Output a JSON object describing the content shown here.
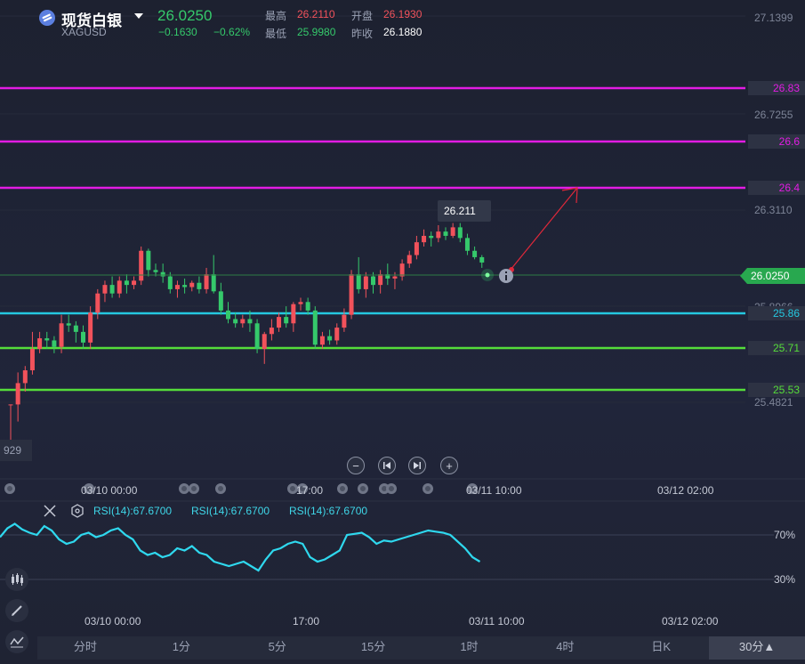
{
  "header": {
    "symbol_name": "现货白银",
    "symbol_code": "XAGUSD",
    "price": "26.0250",
    "change": "−0.1630",
    "change_pct": "−0.62%",
    "high_label": "最高",
    "high_value": "26.2110",
    "open_label": "开盘",
    "open_value": "26.1930",
    "low_label": "最低",
    "low_value": "25.9980",
    "prev_close_label": "昨收",
    "prev_close_value": "26.1880"
  },
  "price_axis": {
    "labels": [
      "27.1399",
      "26.7255",
      "26.3110",
      "25.8966",
      "25.4821"
    ],
    "partial_left_label": "929"
  },
  "levels": [
    {
      "value": "26.83",
      "color": "#e21ce3"
    },
    {
      "value": "26.6",
      "color": "#e21ce3"
    },
    {
      "value": "26.4",
      "color": "#e21ce3"
    },
    {
      "value": "25.86",
      "color": "#25c8e0"
    },
    {
      "value": "25.71",
      "color": "#55dd3a"
    },
    {
      "value": "25.53",
      "color": "#55dd3a"
    }
  ],
  "current_price_tag": "26.0250",
  "high_tooltip": "26.211",
  "time_labels_main": [
    "03/10 00:00",
    "17:00",
    "03/11 10:00",
    "03/12 02:00"
  ],
  "time_labels_rsi": [
    "03/10 00:00",
    "17:00",
    "03/11 10:00",
    "03/12 02:00"
  ],
  "rsi": {
    "labels": [
      "RSI(14):67.6700",
      "RSI(14):67.6700",
      "RSI(14):67.6700"
    ],
    "y_labels": [
      "70%",
      "30%"
    ]
  },
  "tabs": [
    "分时",
    "1分",
    "5分",
    "15分",
    "1时",
    "4时",
    "日K",
    "30分▲"
  ],
  "colors": {
    "up": "#f2525b",
    "down": "#35c96b",
    "rsi_line": "#2fd8ee",
    "background": "#1e2230"
  },
  "chart_data": {
    "type": "candlestick",
    "ylim": [
      25.37,
      27.18
    ],
    "candles": [
      [
        25.36,
        25.36,
        25.18,
        25.36
      ],
      [
        25.36,
        25.51,
        25.28,
        25.46
      ],
      [
        25.46,
        25.54,
        25.42,
        25.52
      ],
      [
        25.52,
        25.7,
        25.5,
        25.62
      ],
      [
        25.62,
        25.7,
        25.6,
        25.67
      ],
      [
        25.67,
        25.7,
        25.62,
        25.66
      ],
      [
        25.66,
        25.68,
        25.6,
        25.63
      ],
      [
        25.63,
        25.78,
        25.6,
        25.74
      ],
      [
        25.74,
        25.78,
        25.7,
        25.73
      ],
      [
        25.73,
        25.75,
        25.65,
        25.7
      ],
      [
        25.7,
        25.73,
        25.62,
        25.65
      ],
      [
        25.65,
        25.82,
        25.62,
        25.79
      ],
      [
        25.79,
        25.9,
        25.76,
        25.88
      ],
      [
        25.88,
        25.94,
        25.84,
        25.92
      ],
      [
        25.92,
        25.96,
        25.86,
        25.88
      ],
      [
        25.88,
        25.96,
        25.86,
        25.94
      ],
      [
        25.94,
        25.97,
        25.88,
        25.92
      ],
      [
        25.92,
        25.96,
        25.9,
        25.94
      ],
      [
        25.94,
        26.1,
        25.92,
        26.08
      ],
      [
        26.08,
        26.09,
        25.96,
        25.99
      ],
      [
        25.99,
        26.02,
        25.96,
        25.98
      ],
      [
        25.98,
        26.02,
        25.93,
        25.96
      ],
      [
        25.96,
        25.98,
        25.88,
        25.9
      ],
      [
        25.9,
        25.94,
        25.86,
        25.92
      ],
      [
        25.92,
        25.95,
        25.88,
        25.91
      ],
      [
        25.91,
        25.94,
        25.89,
        25.93
      ],
      [
        25.93,
        25.96,
        25.88,
        25.9
      ],
      [
        25.9,
        26.0,
        25.88,
        25.97
      ],
      [
        25.97,
        26.06,
        25.88,
        25.89
      ],
      [
        25.89,
        25.93,
        25.78,
        25.8
      ],
      [
        25.8,
        25.84,
        25.74,
        25.76
      ],
      [
        25.76,
        25.79,
        25.72,
        25.74
      ],
      [
        25.74,
        25.78,
        25.72,
        25.76
      ],
      [
        25.76,
        25.8,
        25.7,
        25.74
      ],
      [
        25.74,
        25.76,
        25.6,
        25.62
      ],
      [
        25.62,
        25.7,
        25.55,
        25.69
      ],
      [
        25.69,
        25.76,
        25.66,
        25.72
      ],
      [
        25.72,
        25.79,
        25.7,
        25.77
      ],
      [
        25.77,
        25.82,
        25.72,
        25.74
      ],
      [
        25.74,
        25.84,
        25.7,
        25.83
      ],
      [
        25.83,
        25.86,
        25.8,
        25.84
      ],
      [
        25.84,
        25.86,
        25.78,
        25.8
      ],
      [
        25.8,
        25.82,
        25.62,
        25.64
      ],
      [
        25.64,
        25.7,
        25.62,
        25.68
      ],
      [
        25.68,
        25.71,
        25.64,
        25.66
      ],
      [
        25.66,
        25.74,
        25.64,
        25.72
      ],
      [
        25.72,
        25.81,
        25.7,
        25.78
      ],
      [
        25.78,
        25.99,
        25.76,
        25.97
      ],
      [
        25.97,
        26.05,
        25.88,
        25.9
      ],
      [
        25.9,
        25.98,
        25.86,
        25.96
      ],
      [
        25.96,
        25.98,
        25.88,
        25.92
      ],
      [
        25.92,
        25.99,
        25.88,
        25.97
      ],
      [
        25.97,
        26.02,
        25.92,
        25.95
      ],
      [
        25.95,
        25.98,
        25.9,
        25.96
      ],
      [
        25.96,
        26.04,
        25.94,
        26.02
      ],
      [
        26.02,
        26.08,
        26.0,
        26.06
      ],
      [
        26.06,
        26.15,
        26.04,
        26.12
      ],
      [
        26.12,
        26.18,
        26.1,
        26.15
      ],
      [
        26.15,
        26.17,
        26.1,
        26.14
      ],
      [
        26.14,
        26.2,
        26.12,
        26.17
      ],
      [
        26.17,
        26.19,
        26.13,
        26.15
      ],
      [
        26.15,
        26.21,
        26.14,
        26.19
      ],
      [
        26.19,
        26.21,
        26.12,
        26.14
      ],
      [
        26.14,
        26.16,
        26.06,
        26.08
      ],
      [
        26.08,
        26.1,
        26.04,
        26.05
      ],
      [
        26.05,
        26.06,
        26.0,
        26.025
      ]
    ],
    "rsi": [
      68,
      76,
      80,
      75,
      72,
      70,
      78,
      74,
      66,
      62,
      64,
      70,
      72,
      68,
      70,
      74,
      76,
      70,
      66,
      56,
      52,
      54,
      50,
      52,
      58,
      56,
      60,
      54,
      52,
      46,
      44,
      42,
      44,
      46,
      42,
      38,
      48,
      56,
      58,
      62,
      64,
      62,
      50,
      46,
      48,
      52,
      56,
      70,
      71,
      72,
      68,
      62,
      65,
      64,
      66,
      68,
      70,
      72,
      74,
      73,
      72,
      70,
      64,
      58,
      50,
      46
    ]
  }
}
